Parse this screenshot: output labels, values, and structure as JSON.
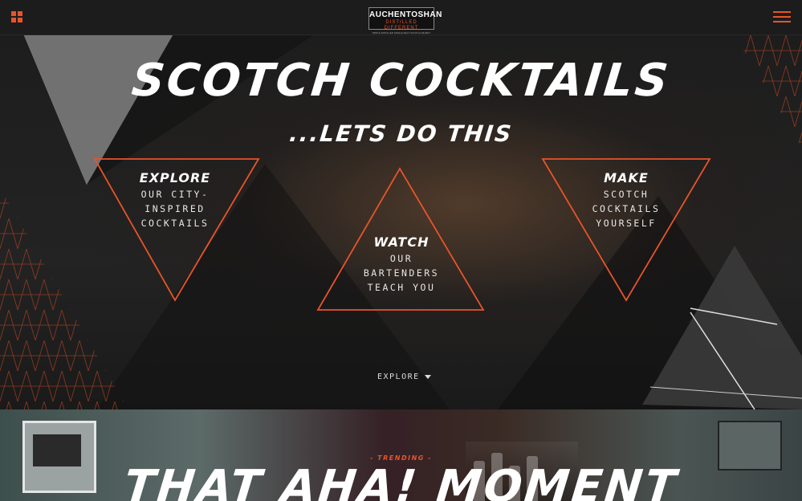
{
  "header": {
    "brand": "AUCHENTOSHAN",
    "tagline": "DISTILLED DIFFERENT",
    "subline": "TRIPLE DISTILLED SINGLE MALT SCOTCH WHISKY",
    "grid_icon": "grid-icon",
    "menu_icon": "hamburger-menu-icon"
  },
  "hero": {
    "title": "SCOTCH COCKTAILS",
    "subtitle": "...LETS DO THIS",
    "links": [
      {
        "heading": "EXPLORE",
        "lines": [
          "OUR CITY-",
          "INSPIRED",
          "COCKTAILS"
        ]
      },
      {
        "heading": "WATCH",
        "lines": [
          "OUR",
          "BARTENDERS",
          "TEACH YOU"
        ]
      },
      {
        "heading": "MAKE",
        "lines": [
          "SCOTCH",
          "COCKTAILS",
          "YOURSELF"
        ]
      }
    ],
    "explore_cta": "EXPLORE"
  },
  "trending": {
    "tag": "- TRENDING -",
    "title": "THAT AHA! MOMENT"
  },
  "colors": {
    "accent": "#e8542a",
    "background": "#1c1c1c",
    "text": "#ffffff"
  }
}
